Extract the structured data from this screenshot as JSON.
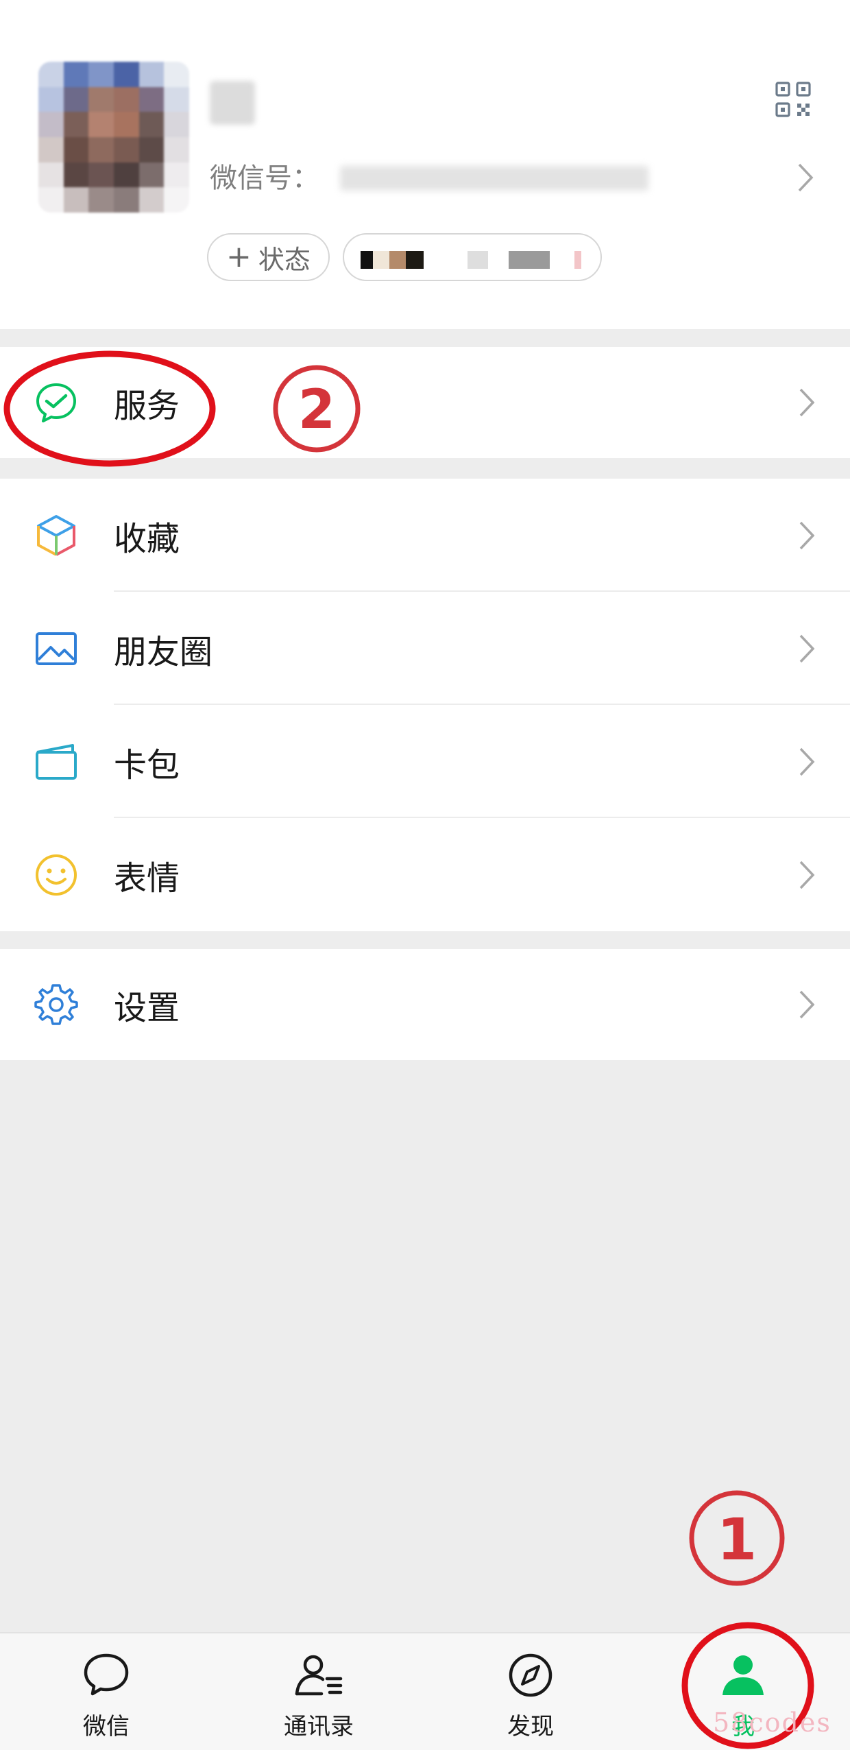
{
  "profile": {
    "wxid_label": "微信号：",
    "status_button": "状态",
    "status_plus": "+"
  },
  "menu": {
    "services": "服务",
    "favorites": "收藏",
    "moments": "朋友圈",
    "cards": "卡包",
    "stickers": "表情",
    "settings": "设置"
  },
  "annotations": {
    "step1": "①",
    "step2": "②"
  },
  "tabbar": {
    "chats": "微信",
    "contacts": "通讯录",
    "discover": "发现",
    "me": "我"
  },
  "watermark": "58codes",
  "colors": {
    "accent_green": "#07c160",
    "annotation_red": "#e0101a",
    "background": "#ededed"
  }
}
